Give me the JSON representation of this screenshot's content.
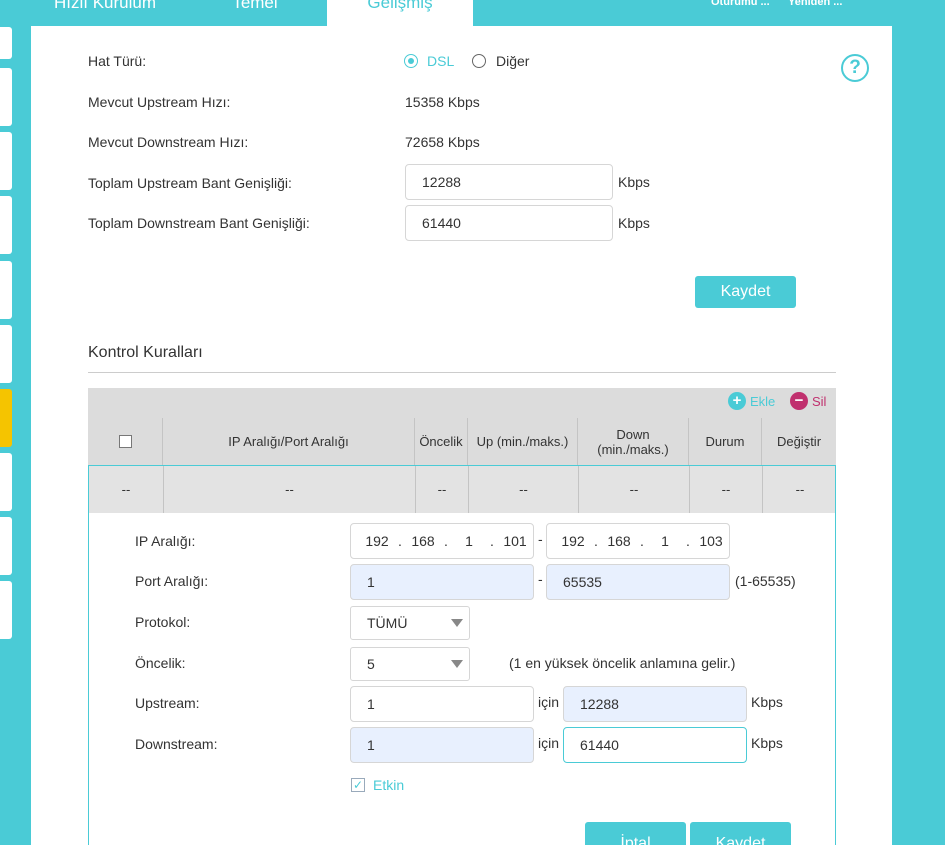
{
  "nav": {
    "tabs": [
      "Hızlı Kurulum",
      "Temel",
      "Gelişmiş"
    ],
    "tools": [
      "Oturumu ...",
      "Yeniden ..."
    ]
  },
  "form": {
    "line_type_label": "Hat Türü:",
    "line_type_options": [
      "DSL",
      "Diğer"
    ],
    "line_type_selected": "DSL",
    "upstream_rate_label": "Mevcut Upstream Hızı:",
    "upstream_rate_value": "15358 Kbps",
    "downstream_rate_label": "Mevcut Downstream Hızı:",
    "downstream_rate_value": "72658 Kbps",
    "total_up_label": "Toplam Upstream Bant Genişliği:",
    "total_up_value": "12288",
    "total_down_label": "Toplam Downstream Bant Genişliği:",
    "total_down_value": "61440",
    "unit": "Kbps",
    "save_label": "Kaydet"
  },
  "rules": {
    "title": "Kontrol Kuralları",
    "add_label": "Ekle",
    "delete_label": "Sil",
    "columns": [
      "IP Aralığı/Port Aralığı",
      "Öncelik",
      "Up (min./maks.)",
      "Down (min./maks.)",
      "Durum",
      "Değiştir"
    ],
    "row": [
      "--",
      "--",
      "--",
      "--",
      "--",
      "--",
      "--"
    ]
  },
  "editor": {
    "ip_label": "IP Aralığı:",
    "ip_start": [
      "192",
      "168",
      "1",
      "101"
    ],
    "ip_end": [
      "192",
      "168",
      "1",
      "103"
    ],
    "port_label": "Port Aralığı:",
    "port_start": "1",
    "port_end": "65535",
    "port_hint": "(1-65535)",
    "protocol_label": "Protokol:",
    "protocol_value": "TÜMÜ",
    "priority_label": "Öncelik:",
    "priority_value": "5",
    "priority_hint": "(1 en yüksek öncelik anlamına gelir.)",
    "upstream_label": "Upstream:",
    "upstream_min": "1",
    "upstream_max": "12288",
    "downstream_label": "Downstream:",
    "downstream_min": "1",
    "downstream_max": "61440",
    "for_label": "için",
    "unit": "Kbps",
    "enable_label": "Etkin",
    "enabled": true,
    "cancel_label": "İptal",
    "save_label": "Kaydet"
  },
  "colors": {
    "accent": "#4acbd6",
    "delete": "#c0306e",
    "sidebar_active": "#f5c400"
  }
}
